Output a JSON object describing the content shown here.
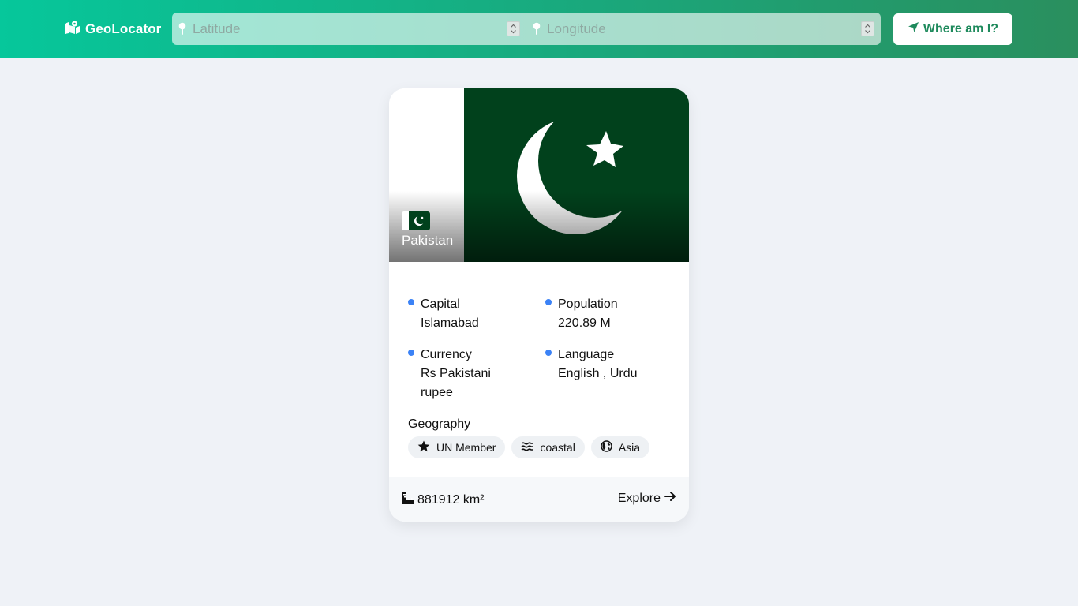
{
  "app": {
    "brand_name": "GeoLocator",
    "brand_icon": "map-location-icon"
  },
  "search": {
    "latitude_placeholder": "Latitude",
    "longitude_placeholder": "Longitude",
    "latitude_value": "",
    "longitude_value": ""
  },
  "locate_button": {
    "label": "Where am I?",
    "icon": "location-arrow-icon"
  },
  "country": {
    "name": "Pakistan",
    "flag_colors": {
      "green": "#01411c",
      "white": "#ffffff"
    },
    "facts": [
      {
        "label": "Capital",
        "value": "Islamabad"
      },
      {
        "label": "Population",
        "value": "220.89 M"
      },
      {
        "label": "Currency",
        "value": "Rs Pakistani rupee"
      },
      {
        "label": "Language",
        "value": "English , Urdu"
      }
    ],
    "geography_title": "Geography",
    "tags": [
      {
        "label": "UN Member",
        "icon": "star-icon"
      },
      {
        "label": "coastal",
        "icon": "water-icon"
      },
      {
        "label": "Asia",
        "icon": "globe-icon"
      }
    ],
    "area": "881912 km²",
    "explore_label": "Explore"
  },
  "colors": {
    "accent": "#1e8a5c",
    "bullet": "#3b82f6",
    "background": "#eff2f7"
  }
}
